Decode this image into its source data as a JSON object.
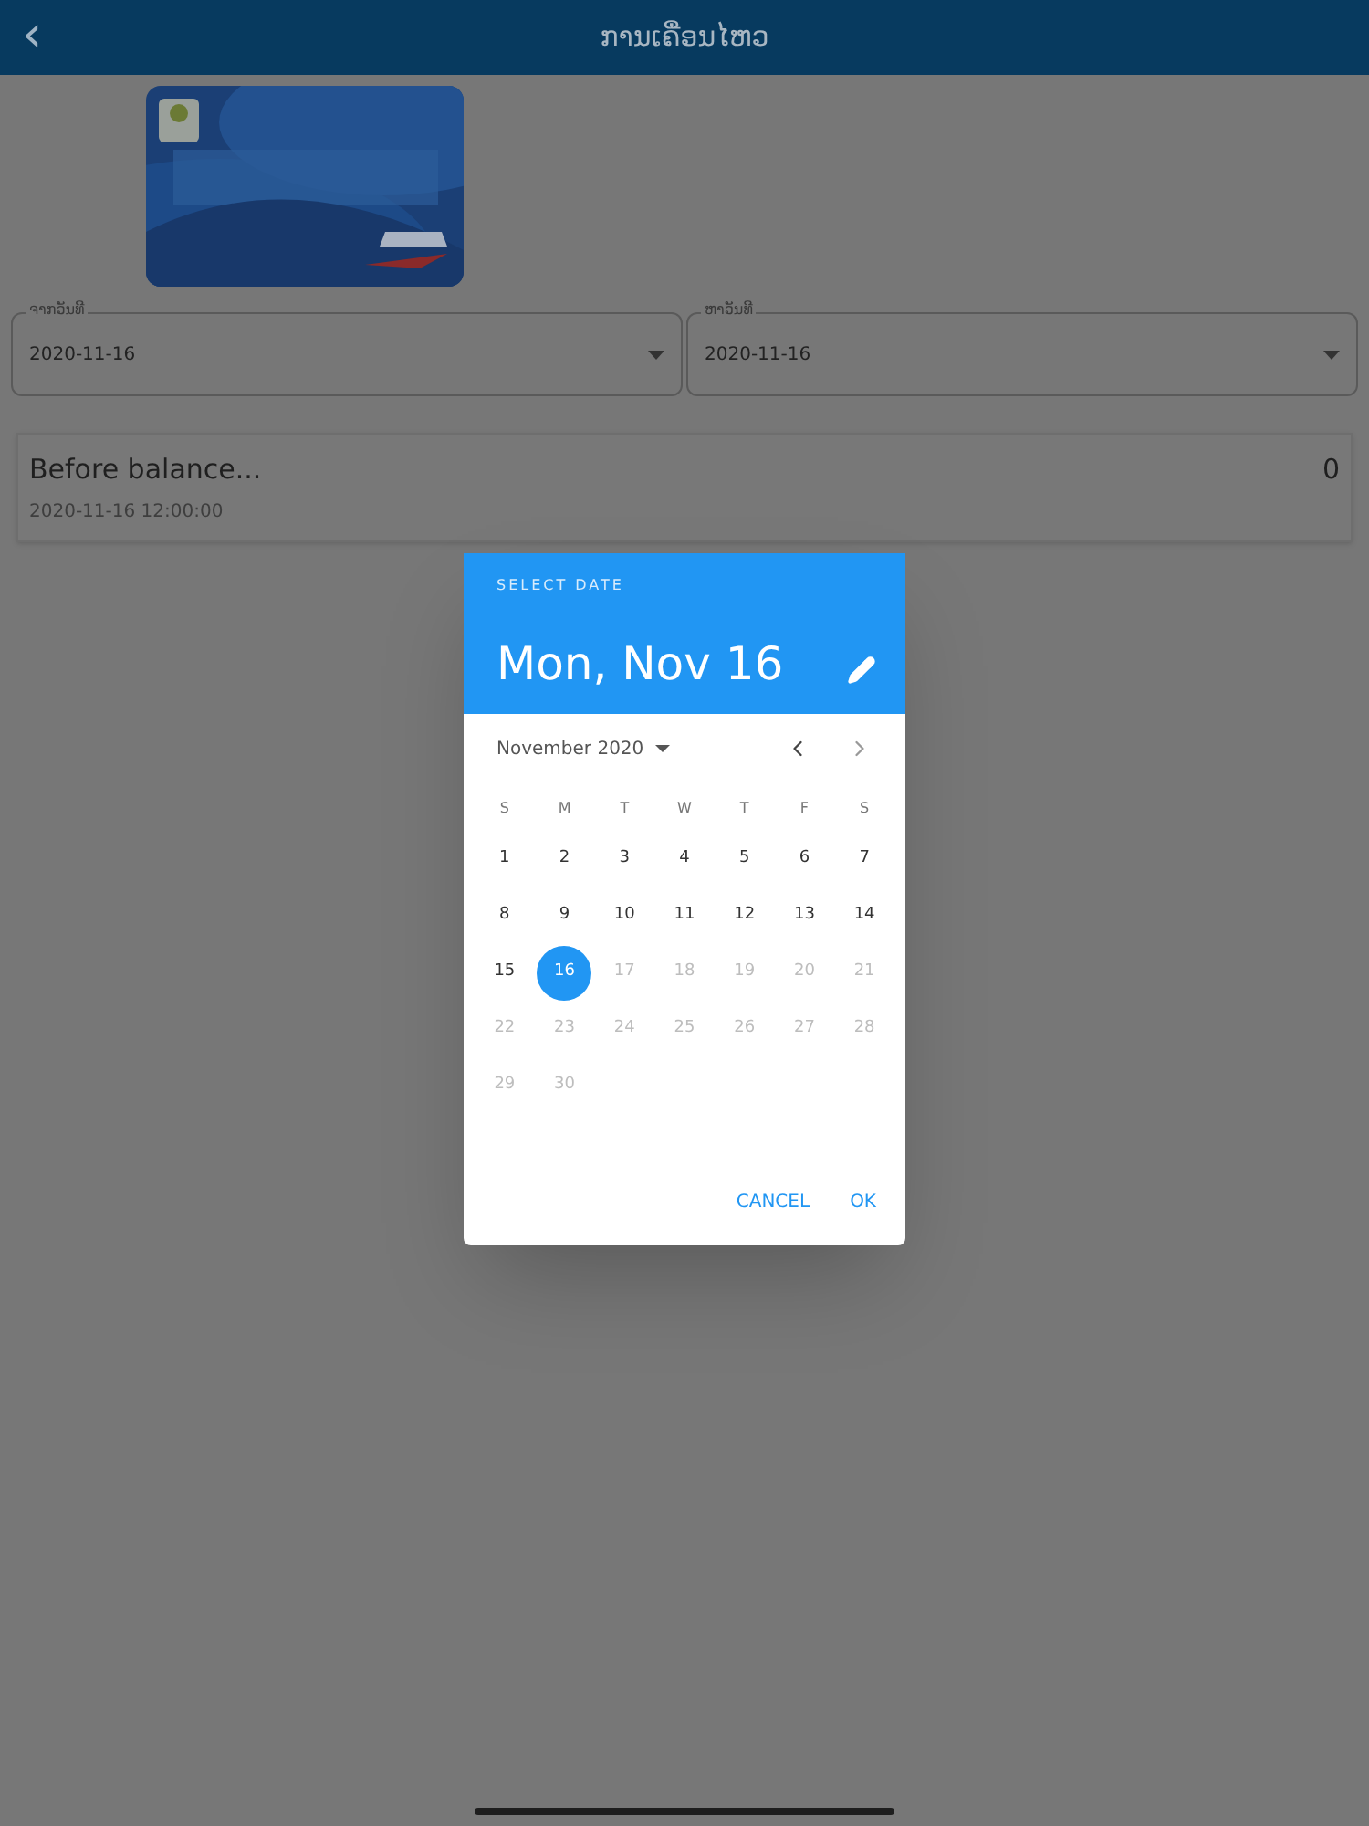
{
  "header": {
    "back": "‹",
    "title": "ການເຄື່ອນໄຫວ"
  },
  "date_fields": [
    {
      "label": "ຈາກວັນທີ",
      "value": "2020-11-16"
    },
    {
      "label": "ຫາວັນທີ",
      "value": "2020-11-16"
    }
  ],
  "balance": {
    "title": "Before balance...",
    "datetime": "2020-11-16 12:00:00",
    "amount": "0"
  },
  "dialog": {
    "caption": "SELECT DATE",
    "selected_date": "Mon, Nov 16",
    "month": "November 2020",
    "weekdays": [
      "S",
      "M",
      "T",
      "W",
      "T",
      "F",
      "S"
    ],
    "days": [
      {
        "label": "1",
        "disabled": false,
        "selected": false
      },
      {
        "label": "2",
        "disabled": false,
        "selected": false
      },
      {
        "label": "3",
        "disabled": false,
        "selected": false
      },
      {
        "label": "4",
        "disabled": false,
        "selected": false
      },
      {
        "label": "5",
        "disabled": false,
        "selected": false
      },
      {
        "label": "6",
        "disabled": false,
        "selected": false
      },
      {
        "label": "7",
        "disabled": false,
        "selected": false
      },
      {
        "label": "8",
        "disabled": false,
        "selected": false
      },
      {
        "label": "9",
        "disabled": false,
        "selected": false
      },
      {
        "label": "10",
        "disabled": false,
        "selected": false
      },
      {
        "label": "11",
        "disabled": false,
        "selected": false
      },
      {
        "label": "12",
        "disabled": false,
        "selected": false
      },
      {
        "label": "13",
        "disabled": false,
        "selected": false
      },
      {
        "label": "14",
        "disabled": false,
        "selected": false
      },
      {
        "label": "15",
        "disabled": false,
        "selected": false
      },
      {
        "label": "16",
        "disabled": false,
        "selected": true
      },
      {
        "label": "17",
        "disabled": true,
        "selected": false
      },
      {
        "label": "18",
        "disabled": true,
        "selected": false
      },
      {
        "label": "19",
        "disabled": true,
        "selected": false
      },
      {
        "label": "20",
        "disabled": true,
        "selected": false
      },
      {
        "label": "21",
        "disabled": true,
        "selected": false
      },
      {
        "label": "22",
        "disabled": true,
        "selected": false
      },
      {
        "label": "23",
        "disabled": true,
        "selected": false
      },
      {
        "label": "24",
        "disabled": true,
        "selected": false
      },
      {
        "label": "25",
        "disabled": true,
        "selected": false
      },
      {
        "label": "26",
        "disabled": true,
        "selected": false
      },
      {
        "label": "27",
        "disabled": true,
        "selected": false
      },
      {
        "label": "28",
        "disabled": true,
        "selected": false
      },
      {
        "label": "29",
        "disabled": true,
        "selected": false
      },
      {
        "label": "30",
        "disabled": true,
        "selected": false
      }
    ],
    "buttons": [
      "CANCEL",
      "OK"
    ]
  }
}
